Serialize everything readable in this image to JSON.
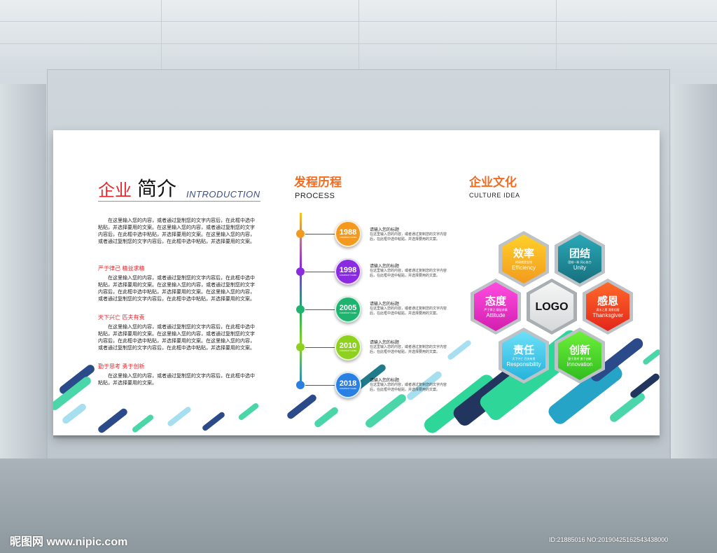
{
  "left": {
    "title_red": "企业",
    "title_black": "简介",
    "title_en": "INTRODUCTION",
    "para1": "在这里输入您的内容，或者通过复制您的文字内容后，在此框中选中粘贴，并选择要用的文案。在这里输入您的内容，或者通过复制您的文字内容后，在此框中选中粘贴，并选择要用的文案。在这里输入您的内容，或者通过复制您的文字内容后，在此框中选中粘贴，并选择要用的文案。",
    "sub1": "严于律己    精益求精",
    "para2": "在这里输入您的内容，或者通过复制您的文字内容后，在此框中选中粘贴，并选择要用的文案。在这里输入您的内容，或者通过复制您的文字内容后，在此框中选中粘贴，并选择要用的文案。在这里输入您的内容，或者通过复制您的文字内容后，在此框中选中粘贴，并选择要用的文案。",
    "sub2": "天下兴亡    匹夫有责",
    "para3": "在这里输入您的内容，或者通过复制您的文字内容后，在此框中选中粘贴，并选择要用的文案。在这里输入您的内容，或者通过复制您的文字内容后，在此框中选中粘贴，并选择要用的文案。在这里输入您的内容，或者通过复制您的文字内容后，在此框中选中粘贴，并选择要用的文案。",
    "sub3": "勤于思考    勇于创新",
    "para4": "在这里输入您的内容，或者通过复制您的文字内容后，在此框中选中粘贴，并选择要用的文案。"
  },
  "process": {
    "title": "发程历程",
    "title_en": "PROCESS",
    "events": [
      {
        "year": "1988",
        "tag": "COMPANY NAME",
        "title": "请输入您的标题",
        "body": "在这里输入您的内容，或者通过复制您的文字内容后，在此框中选中粘贴，并选择要用的文案。",
        "color": "#f39a1e"
      },
      {
        "year": "1998",
        "tag": "COMPANY NAME",
        "title": "请输入您的标题",
        "body": "在这里输入您的内容，或者通过复制您的文字内容后，在此框中选中粘贴，并选择要用的文案。",
        "color": "#8a2be2"
      },
      {
        "year": "2005",
        "tag": "COMPANY NAME",
        "title": "请输入您的标题",
        "body": "在这里输入您的内容，或者通过复制您的文字内容后，在此框中选中粘贴，并选择要用的文案。",
        "color": "#1fb36f"
      },
      {
        "year": "2010",
        "tag": "COMPANY NAME",
        "title": "请输入您的标题",
        "body": "在这里输入您的内容，或者通过复制您的文字内容后，在此框中选中粘贴，并选择要用的文案。",
        "color": "#8ed11f"
      },
      {
        "year": "2018",
        "tag": "COMPANY NAME",
        "title": "请输入您的标题",
        "body": "在这里输入您的内容，或者通过复制您的文字内容后，在此框中选中粘贴，并选择要用的文案。",
        "color": "#2a7fe3"
      }
    ]
  },
  "culture": {
    "title": "企业文化",
    "title_en": "CULTURE  IDEA",
    "logo": "LOGO",
    "values": {
      "efficiency": {
        "cn": "效率",
        "small": "时间就是金钱",
        "en": "Efficiency",
        "color": "#f7a51a"
      },
      "unity": {
        "cn": "团结",
        "small": "团结一致 同心协力",
        "en": "Unity",
        "color": "#1a8a9c"
      },
      "attitude": {
        "cn": "态度",
        "small": "严于律己 精益求精",
        "en": "Attitude",
        "color": "#e62bc8"
      },
      "thanksgiver": {
        "cn": "感恩",
        "small": "滴水之恩 涌泉相报",
        "en": "Thanksgiver",
        "color": "#f03a1e"
      },
      "responsibility": {
        "cn": "责任",
        "small": "天下兴亡 匹夫有责",
        "en": "Responsibility",
        "color": "#39c6e8"
      },
      "innovation": {
        "cn": "创新",
        "small": "勤于思考 勇于创新",
        "en": "Innovation",
        "color": "#45d12a"
      }
    }
  },
  "watermark": {
    "left": "昵图网 www.nipic.com",
    "right": "ID:21885016 NO:20190425162543438000"
  }
}
